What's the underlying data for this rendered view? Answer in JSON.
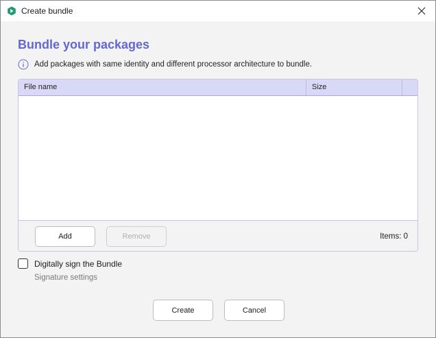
{
  "window": {
    "title": "Create bundle",
    "accent_color": "#6466d8"
  },
  "main": {
    "heading": "Bundle your packages",
    "info_text": "Add packages with same identity and different processor architecture to bundle."
  },
  "table": {
    "columns": [
      "File name",
      "Size"
    ],
    "rows": [],
    "add_label": "Add",
    "remove_label": "Remove",
    "items_count": "Items: 0"
  },
  "signing": {
    "checkbox_label": "Digitally sign the Bundle",
    "checked": false,
    "settings_label": "Signature settings"
  },
  "footer": {
    "create_label": "Create",
    "cancel_label": "Cancel"
  }
}
